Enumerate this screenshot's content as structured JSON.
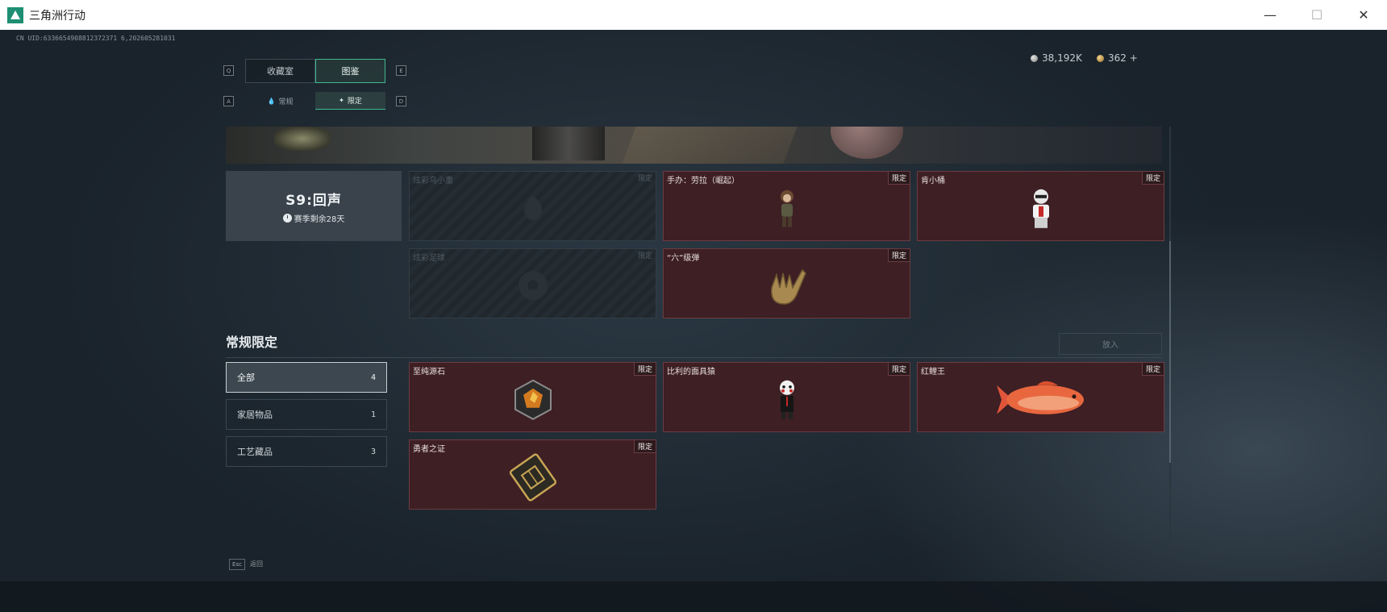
{
  "window": {
    "title": "三角洲行动",
    "min_glyph": "—",
    "max_glyph": "☐",
    "close_glyph": "✕"
  },
  "uid": "CN UID:6336654908812372371 6,202605281031",
  "tabs": {
    "left_key": "Q",
    "right_key": "E",
    "items": [
      {
        "label": "收藏室",
        "active": false
      },
      {
        "label": "图鉴",
        "active": true
      }
    ]
  },
  "subtabs": {
    "left_key": "A",
    "right_key": "D",
    "items": [
      {
        "label": "常规",
        "icon": "drop-icon",
        "active": false
      },
      {
        "label": "限定",
        "icon": "star-icon",
        "active": true
      }
    ]
  },
  "currency": {
    "silver": "38,192K",
    "gold": "362 +"
  },
  "season": {
    "title": "S9:回声",
    "remain": "赛季剩余28天"
  },
  "season_items": [
    {
      "name": "炫彩乌小重",
      "tag": "限定",
      "locked": true,
      "icon": "bird-icon"
    },
    {
      "name": "手办：劳拉（崛起）",
      "tag": "限定",
      "locked": false,
      "icon": "figure-icon"
    },
    {
      "name": "肯小桶",
      "tag": "限定",
      "locked": false,
      "icon": "figure-icon"
    },
    {
      "name": "炫彩足球",
      "tag": "限定",
      "locked": true,
      "icon": "ball-icon"
    },
    {
      "name": "“六”级弹",
      "tag": "限定",
      "locked": false,
      "icon": "hand-icon"
    }
  ],
  "section": {
    "title": "常规限定",
    "place_button": "放入"
  },
  "filters": [
    {
      "label": "全部",
      "count": "4",
      "active": true
    },
    {
      "label": "家居物品",
      "count": "1",
      "active": false
    },
    {
      "label": "工艺藏品",
      "count": "3",
      "active": false
    }
  ],
  "regular_items": [
    {
      "name": "至纯源石",
      "tag": "限定",
      "icon": "gem-icon"
    },
    {
      "name": "比利的面具猿",
      "tag": "限定",
      "icon": "puppet-icon"
    },
    {
      "name": "红鲤王",
      "tag": "限定",
      "icon": "fish-icon"
    },
    {
      "name": "勇者之证",
      "tag": "限定",
      "icon": "card-icon"
    }
  ],
  "footer": {
    "esc_key": "Esc",
    "back_label": "返回"
  }
}
